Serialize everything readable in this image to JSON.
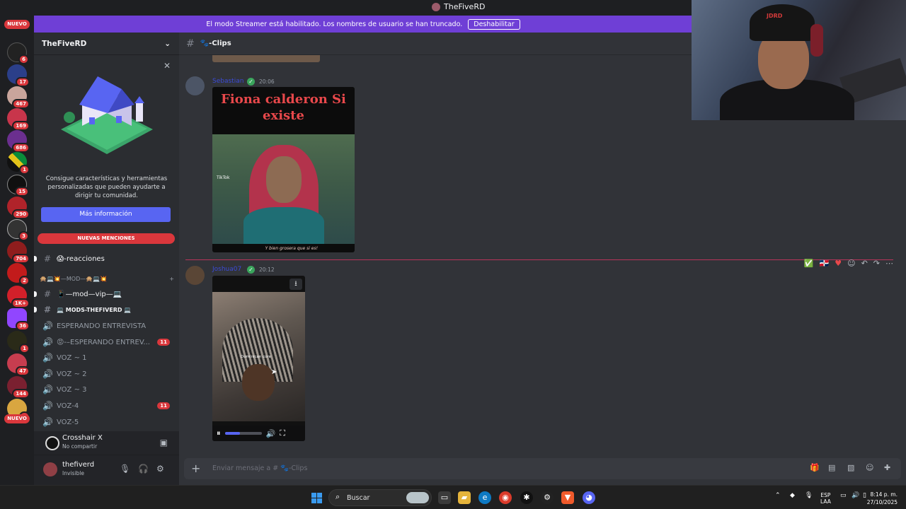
{
  "window": {
    "title": "TheFiveRD"
  },
  "banner": {
    "text": "El modo Streamer está habilitado. Los nombres de usuario se han truncado.",
    "button": "Deshabilitar"
  },
  "servers": {
    "new_top": "NUEVO",
    "new_bottom": "NUEVO",
    "items": [
      {
        "badge": "1"
      },
      {
        "badge": "6"
      },
      {
        "badge": "17"
      },
      {
        "badge": "467"
      },
      {
        "badge": "169"
      },
      {
        "badge": "686"
      },
      {
        "badge": "1"
      },
      {
        "badge": "15"
      },
      {
        "badge": "290"
      },
      {
        "badge": "3"
      },
      {
        "badge": "704"
      },
      {
        "badge": "2"
      },
      {
        "badge": "1K+"
      },
      {
        "badge": "36"
      },
      {
        "badge": "1"
      },
      {
        "badge": "47"
      },
      {
        "badge": "144"
      },
      {
        "badge": "6"
      }
    ]
  },
  "guild": {
    "name": "TheFiveRD",
    "promo": {
      "text": "Consigue características y herramientas personalizadas que pueden ayudarte a dirigir tu comunidad.",
      "button": "Más información"
    },
    "mentions_pill": "NUEVAS MENCIONES",
    "channels": [
      {
        "icon": "#",
        "label": "😱-reacciones"
      },
      {
        "icon": "#",
        "label": "📱—mod—vip—💻"
      },
      {
        "icon": "#",
        "label": "💻 MODS-THEFIVERD 💻"
      },
      {
        "icon": "🔊",
        "label": "ESPERANDO ENTREVISTA"
      },
      {
        "icon": "🔊",
        "label": "😡-–ESPERANDO ENTREV...",
        "badge": "11"
      },
      {
        "icon": "🔊",
        "label": "VOZ ~ 1"
      },
      {
        "icon": "🔊",
        "label": "VOZ ~ 2"
      },
      {
        "icon": "🔊",
        "label": "VOZ ~ 3"
      },
      {
        "icon": "🔊",
        "label": "VOZ-4",
        "badge": "11"
      },
      {
        "icon": "🔊",
        "label": "VOZ-5"
      }
    ],
    "category": "🙊💻💥—MOD—🙊💻💥"
  },
  "activity": {
    "name": "Crosshair X",
    "status": "No compartir"
  },
  "user": {
    "name": "thefiverd",
    "status": "Invisible"
  },
  "channel": {
    "name": "🐾-Clips"
  },
  "messages": [
    {
      "author": "Sebastian",
      "time": "20:06",
      "image_title": "Fiona calderon Si existe",
      "image_brand": "TikTok",
      "image_caption": "Y bien grosera que si es!"
    },
    {
      "author": "Joshua07",
      "time": "20:12",
      "video_label": "Dominican core",
      "video_progress": 0.42
    }
  ],
  "composer": {
    "placeholder": "Enviar mensaje a # 🐾-Clips"
  },
  "webcam": {
    "hat_text": "JDRD"
  },
  "taskbar": {
    "search": "Buscar",
    "lang1": "ESP",
    "lang2": "LAA",
    "time": "8:14 p. m.",
    "date": "27/10/2025"
  },
  "colors": {
    "accent": "#5865f2",
    "banner": "#6f3fd6",
    "badge": "#da373c"
  }
}
